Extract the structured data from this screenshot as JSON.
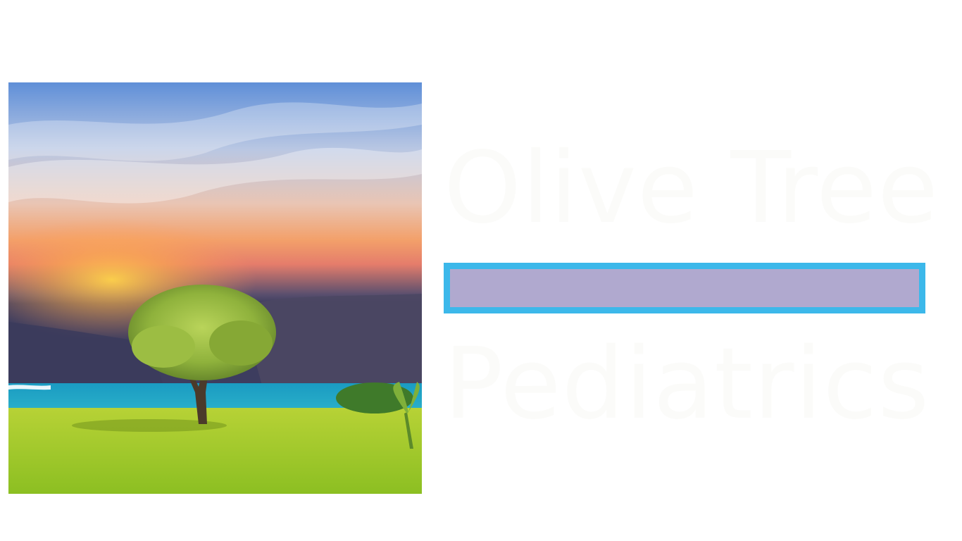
{
  "logo": {
    "line1": "Olive Tree",
    "line2": "Pediatrics",
    "text_color": "#fbfbf9",
    "bar_border_color": "#3cb8ea",
    "bar_fill_color": "#b0a9cf"
  },
  "image": {
    "subject": "lone tree on grassy shore at sunset with ocean"
  }
}
